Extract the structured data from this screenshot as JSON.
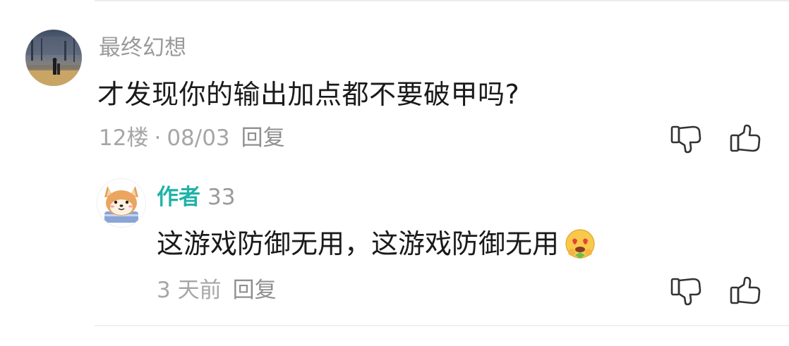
{
  "comment": {
    "username": "最终幻想",
    "text": "才发现你的输出加点都不要破甲吗?",
    "floor": "12楼",
    "separator": "·",
    "date": "08/03",
    "reply_label": "回复",
    "icons": [
      "thumb-down-icon",
      "thumb-up-icon"
    ]
  },
  "reply": {
    "author_tag": "作者",
    "username": "33",
    "text": "这游戏防御无用，这游戏防御无用",
    "emoji": "heart-eyes-emoji",
    "time": "3 天前",
    "reply_label": "回复",
    "icons": [
      "thumb-down-icon",
      "thumb-up-icon"
    ]
  },
  "colors": {
    "author_accent": "#1fb3a8",
    "meta_gray": "#a6a6a6",
    "text_dark": "#1a1a1a"
  }
}
